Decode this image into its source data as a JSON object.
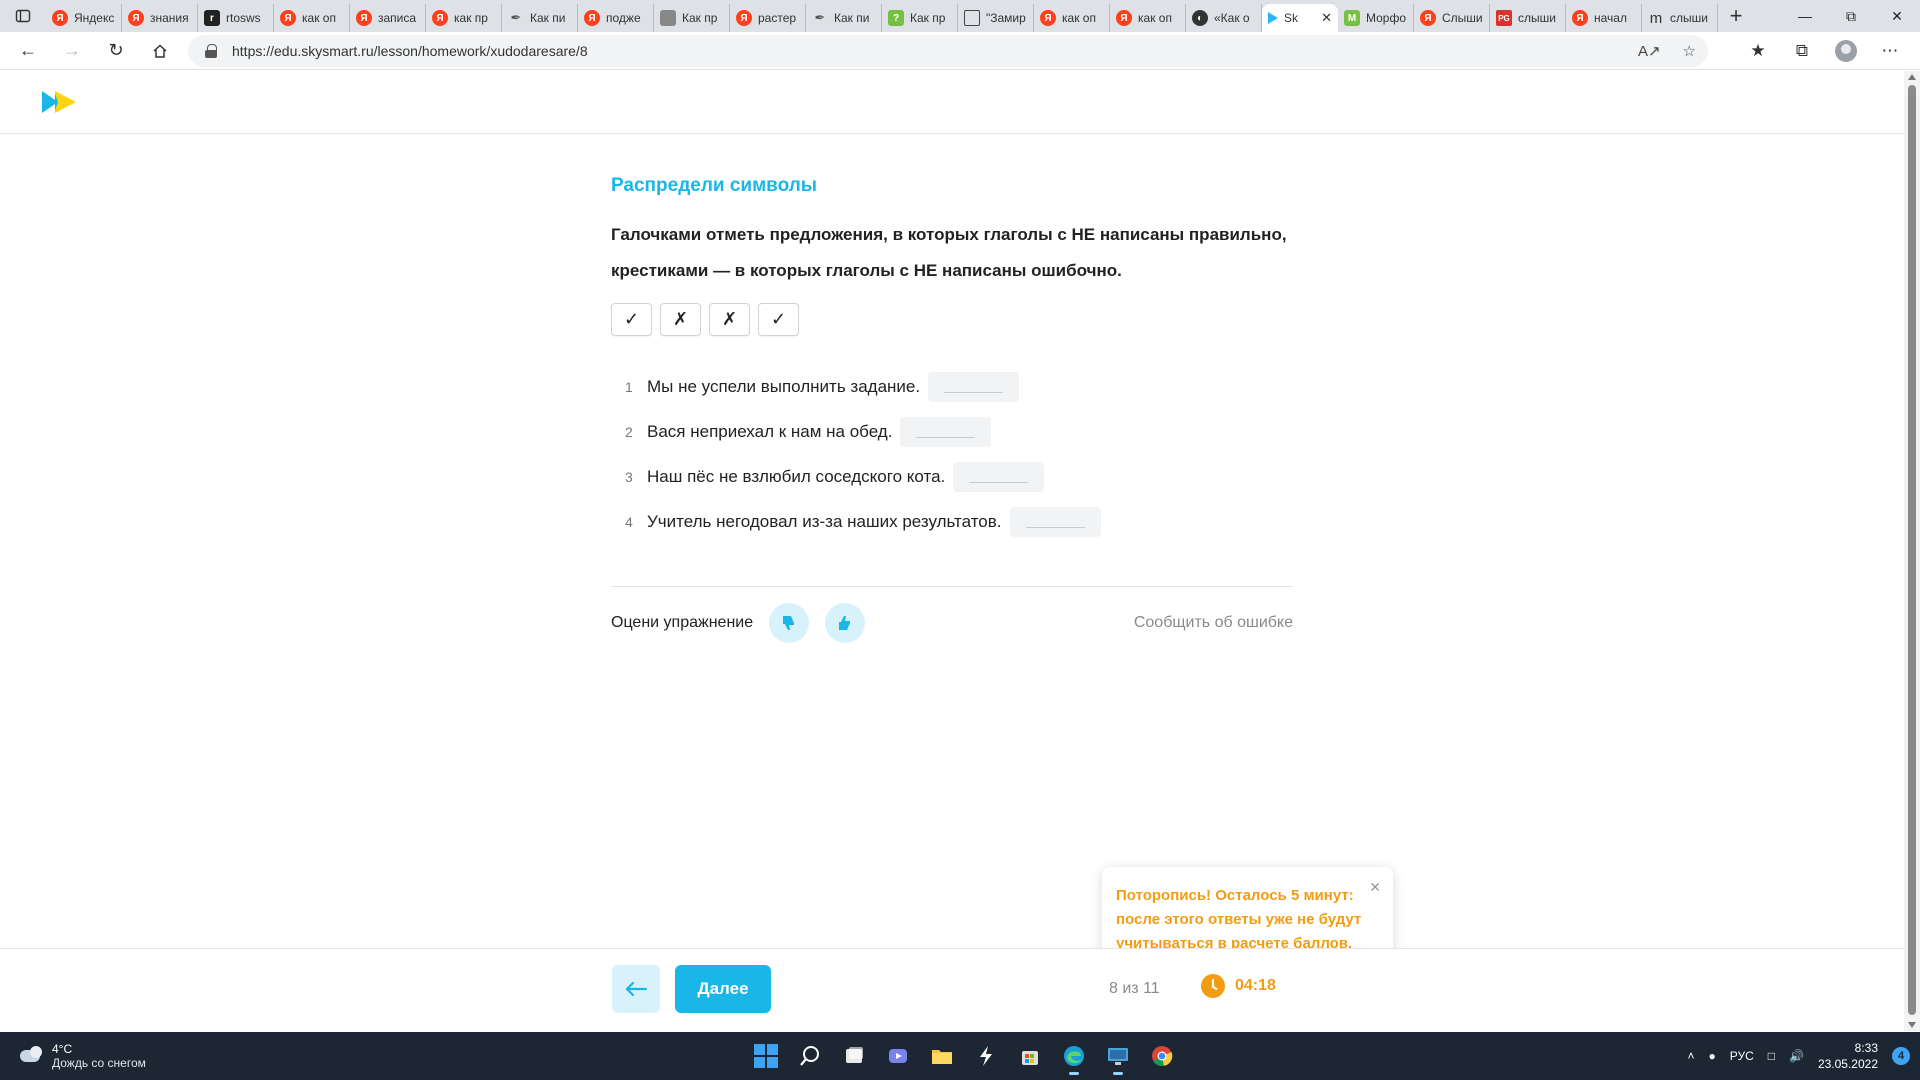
{
  "browser": {
    "tabs": [
      {
        "title": "Яндекс",
        "icon": "yandex-icon",
        "fav": "ya",
        "glyph": "Я"
      },
      {
        "title": "знания",
        "icon": "yandex-icon",
        "fav": "ya",
        "glyph": "Я"
      },
      {
        "title": "rtosws",
        "icon": "site-icon",
        "fav": "dark",
        "glyph": "r"
      },
      {
        "title": "как оп",
        "icon": "yandex-icon",
        "fav": "ya",
        "glyph": "Я"
      },
      {
        "title": "записа",
        "icon": "yandex-icon",
        "fav": "ya",
        "glyph": "Я"
      },
      {
        "title": "как пр",
        "icon": "yandex-icon",
        "fav": "ya",
        "glyph": "Я"
      },
      {
        "title": "Как пи",
        "icon": "feather-icon",
        "fav": "feather",
        "glyph": "✒"
      },
      {
        "title": "подже",
        "icon": "yandex-icon",
        "fav": "ya",
        "glyph": "Я"
      },
      {
        "title": "Как пр",
        "icon": "site-icon",
        "fav": "gray",
        "glyph": ""
      },
      {
        "title": "растер",
        "icon": "yandex-icon",
        "fav": "ya",
        "glyph": "Я"
      },
      {
        "title": "Как пи",
        "icon": "feather-icon",
        "fav": "feather",
        "glyph": "✒"
      },
      {
        "title": "Как пр",
        "icon": "site-icon",
        "fav": "green",
        "glyph": "?"
      },
      {
        "title": "\"Замир",
        "icon": "book-icon",
        "fav": "book",
        "glyph": ""
      },
      {
        "title": "как оп",
        "icon": "yandex-icon",
        "fav": "ya",
        "glyph": "Я"
      },
      {
        "title": "как оп",
        "icon": "yandex-icon",
        "fav": "ya",
        "glyph": "Я"
      },
      {
        "title": "«Как о",
        "icon": "site-icon",
        "fav": "blk",
        "glyph": "◐"
      },
      {
        "title": "Sk",
        "icon": "skysmart-icon",
        "fav": "sky",
        "glyph": "",
        "active": true
      },
      {
        "title": "Морфо",
        "icon": "site-icon",
        "fav": "green",
        "glyph": "M"
      },
      {
        "title": "Слыши",
        "icon": "yandex-icon",
        "fav": "ya",
        "glyph": "Я"
      },
      {
        "title": "слыши",
        "icon": "site-icon",
        "fav": "pg",
        "glyph": "PG"
      },
      {
        "title": "начал",
        "icon": "yandex-icon",
        "fav": "ya",
        "glyph": "Я"
      },
      {
        "title": "слыши",
        "icon": "site-icon",
        "fav": "m",
        "glyph": "m"
      }
    ],
    "address": "https://edu.skysmart.ru/lesson/homework/xudodaresare/8"
  },
  "exercise": {
    "title": "Распредели символы",
    "instruction_line1": "Галочками отметь предложения, в которых глаголы с НЕ написаны правильно,",
    "instruction_line2": "крестиками — в которых глаголы с НЕ написаны ошибочно.",
    "symbols": [
      "✓",
      "✗",
      "✗",
      "✓"
    ],
    "sentences": [
      {
        "num": "1",
        "text": "Мы не успели выполнить задание."
      },
      {
        "num": "2",
        "text": "Вася неприехал к нам на обед."
      },
      {
        "num": "3",
        "text": "Наш пёс не взлюбил соседского кота."
      },
      {
        "num": "4",
        "text": "Учитель негодовал из-за наших результатов."
      }
    ],
    "rate_label": "Оцени упражнение",
    "report_label": "Сообщить об ошибке"
  },
  "footer": {
    "next_label": "Далее",
    "progress": "8 из 11",
    "timer": "04:18"
  },
  "toast": {
    "message": "Поторопись! Осталось 5 минут: после этого ответы уже не будут учитываться в расчете баллов."
  },
  "taskbar": {
    "temperature": "4°C",
    "weather": "Дождь со снегом",
    "language": "РУС",
    "time": "8:33",
    "date": "23.05.2022",
    "notifications": "4"
  },
  "colors": {
    "accent": "#1ab6e8",
    "warning": "#f39c12",
    "light_accent": "#d8f2fb"
  }
}
